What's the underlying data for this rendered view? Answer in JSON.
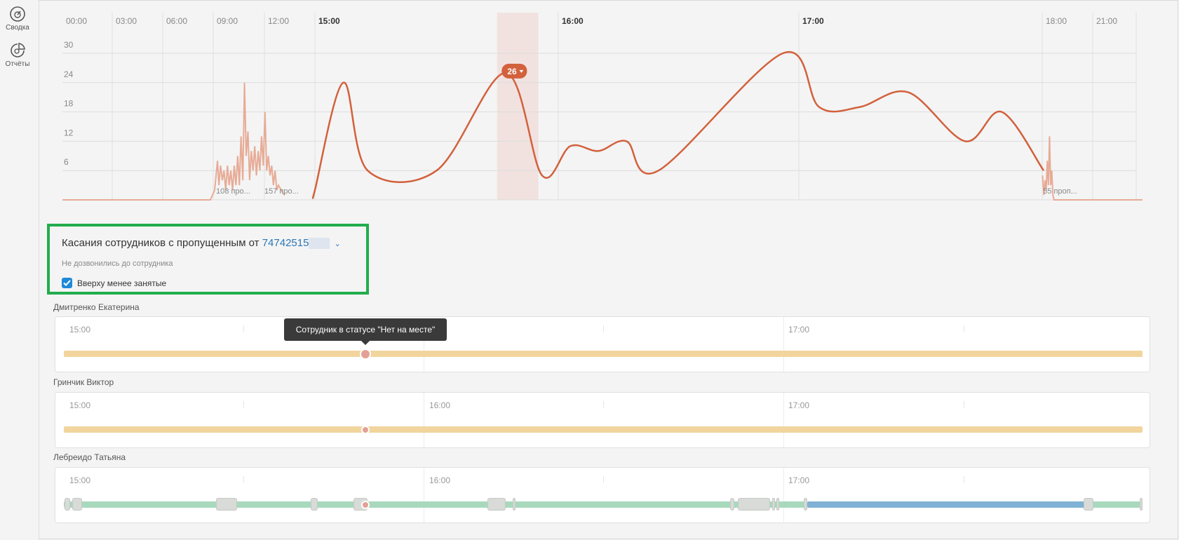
{
  "sidebar": {
    "items": [
      {
        "label": "Сводка",
        "icon": "speedometer-icon"
      },
      {
        "label": "Отчёты",
        "icon": "pie-chart-icon"
      }
    ]
  },
  "timeline": {
    "ticks": [
      "00:00",
      "03:00",
      "06:00",
      "09:00",
      "12:00",
      "15:00",
      "16:00",
      "17:00",
      "18:00",
      "21:00"
    ],
    "bold_ticks": [
      "15:00",
      "16:00",
      "17:00"
    ]
  },
  "chart_data": {
    "type": "line",
    "ylim": [
      0,
      30
    ],
    "y_ticks": [
      6,
      12,
      18,
      24,
      30
    ],
    "highlight_badge": "26",
    "annotations": [
      "108 про...",
      "157 про...",
      "55 проп..."
    ],
    "colors": {
      "main_line": "#d2613c",
      "light_line": "#e7ab96",
      "highlight": "#f1e2e0"
    },
    "main_series_points": [
      {
        "t": "15:00",
        "v": 2
      },
      {
        "t": "15:07",
        "v": 24
      },
      {
        "t": "15:13",
        "v": 6
      },
      {
        "t": "15:30",
        "v": 6
      },
      {
        "t": "15:47",
        "v": 26
      },
      {
        "t": "15:56",
        "v": 5
      },
      {
        "t": "16:03",
        "v": 11
      },
      {
        "t": "16:10",
        "v": 10
      },
      {
        "t": "16:17",
        "v": 12
      },
      {
        "t": "16:25",
        "v": 6
      },
      {
        "t": "16:56",
        "v": 30
      },
      {
        "t": "17:05",
        "v": 19
      },
      {
        "t": "17:15",
        "v": 19
      },
      {
        "t": "17:27",
        "v": 22
      },
      {
        "t": "17:41",
        "v": 12
      },
      {
        "t": "17:50",
        "v": 18
      },
      {
        "t": "18:05",
        "v": 6
      }
    ]
  },
  "panel": {
    "title_prefix": "Касания сотрудников с пропущенным от ",
    "title_number": "74742515",
    "subtitle": "Не дозвонились до сотрудника",
    "checkbox_label": "Вверху менее занятые",
    "checkbox_checked": true
  },
  "employees": [
    {
      "name": "Дмитренко Екатерина",
      "times": [
        "15:00",
        "17:00"
      ],
      "bar_color": "#f1d59d"
    },
    {
      "name": "Гринчик Виктор",
      "times": [
        "15:00",
        "16:00",
        "17:00"
      ],
      "bar_color": "#f1d59d"
    },
    {
      "name": "Лебреидо  Татьяна",
      "times": [
        "15:00",
        "16:00",
        "17:00"
      ],
      "bar_color": "#a8d9bd",
      "bar_color_2": "#7fb2d4"
    }
  ],
  "tooltip": {
    "text": "Сотрудник в статусе \"Нет на месте\""
  }
}
